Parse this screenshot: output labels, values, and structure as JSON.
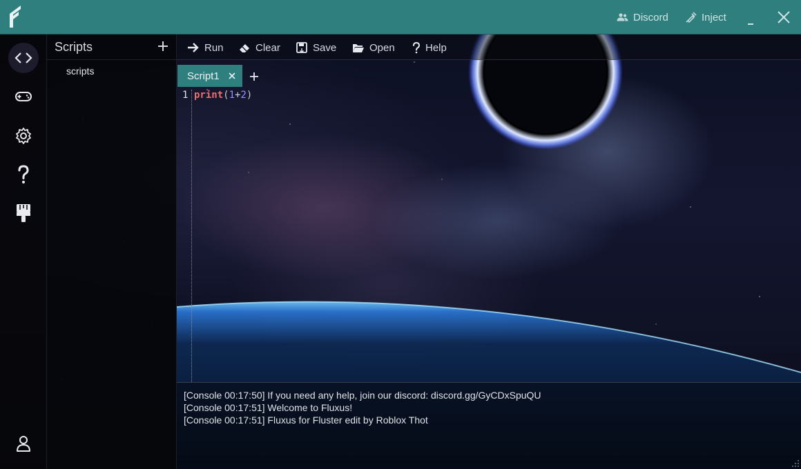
{
  "titlebar": {
    "discord_label": "Discord",
    "inject_label": "Inject",
    "accent_color": "#2f7f7f"
  },
  "rail": {
    "items": [
      {
        "icon": "code-icon",
        "active": true
      },
      {
        "icon": "gamepad-icon",
        "active": false
      },
      {
        "icon": "gear-icon",
        "active": false
      },
      {
        "icon": "question-icon",
        "active": false
      },
      {
        "icon": "paint-brush-icon",
        "active": false
      },
      {
        "icon": "user-icon",
        "active": false
      }
    ]
  },
  "scripts_panel": {
    "title": "Scripts",
    "items": [
      {
        "label": "scripts"
      }
    ]
  },
  "toolbar": {
    "run_label": "Run",
    "clear_label": "Clear",
    "save_label": "Save",
    "open_label": "Open",
    "help_label": "Help"
  },
  "tabs": [
    {
      "label": "Script1",
      "active": true
    }
  ],
  "editor": {
    "line_number": "1",
    "code_tokens": {
      "keyword": "print",
      "open_paren": "(",
      "num1": "1",
      "op": "+",
      "num2": "2",
      "close_paren": ")"
    }
  },
  "console": {
    "lines": [
      "[Console 00:17:50] If you need any help, join our discord: discord.gg/GyCDxSpuQU",
      "[Console 00:17:51] Welcome to Fluxus!",
      "[Console 00:17:51] Fluxus for Fluster edit by Roblox Thot"
    ]
  }
}
